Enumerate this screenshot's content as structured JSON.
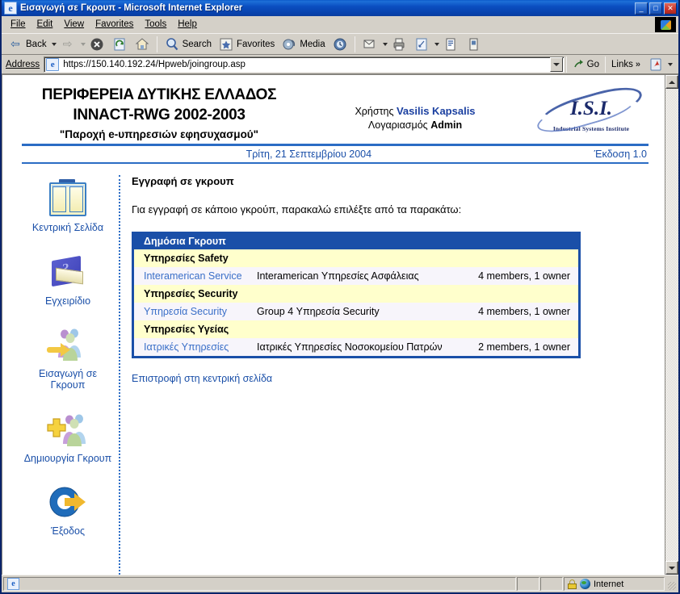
{
  "window": {
    "title": "Εισαγωγή σε Γκρουπ - Microsoft Internet Explorer",
    "minimize_label": "_",
    "maximize_label": "□",
    "close_label": "✕"
  },
  "menu": {
    "items": [
      {
        "label": "File"
      },
      {
        "label": "Edit"
      },
      {
        "label": "View"
      },
      {
        "label": "Favorites"
      },
      {
        "label": "Tools"
      },
      {
        "label": "Help"
      }
    ]
  },
  "toolbar": {
    "back_label": "Back",
    "forward_label": "",
    "stop_label": "",
    "refresh_label": "",
    "home_label": "",
    "search_label": "Search",
    "favorites_label": "Favorites",
    "media_label": "Media",
    "history_label": "",
    "mail_label": "",
    "print_label": "",
    "edit_label": "",
    "discuss_label": "",
    "messenger_label": ""
  },
  "address": {
    "label": "Address",
    "url": "https://150.140.192.24/Hpweb/joingroup.asp",
    "go_label": "Go",
    "links_label": "Links",
    "links_chevron": "»"
  },
  "site_header": {
    "line1": "ΠΕΡΙΦΕΡΕΙΑ ΔΥΤΙΚΗΣ ΕΛΛΑΔΟΣ",
    "line2": "INNACT-RWG 2002-2003",
    "line3": "\"Παροχή e-υπηρεσιών εφησυχασμού\"",
    "user_label": "Χρήστης",
    "user_name": "Vasilis Kapsalis",
    "account_label": "Λογαριασμός",
    "account_name": "Admin",
    "logo_text": "I.S.I.",
    "logo_subtitle": "Industrial Systems Institute",
    "date": "Τρίτη, 21 Σεπτεμβρίου 2004",
    "version": "Έκδοση 1.0",
    "accent_color": "#2b6cc4"
  },
  "sidebar": {
    "items": [
      {
        "label": "Κεντρική Σελίδα",
        "icon": "home-pages-icon"
      },
      {
        "label": "Εγχειρίδιο",
        "icon": "manual-book-icon"
      },
      {
        "label": "Εισαγωγή σε Γκρουπ",
        "icon": "join-group-icon"
      },
      {
        "label": "Δημιουργία Γκρουπ",
        "icon": "create-group-icon"
      },
      {
        "label": "Έξοδος",
        "icon": "exit-icon"
      }
    ]
  },
  "main": {
    "title": "Εγγραφή σε γκρουπ",
    "lead": "Για εγγραφή σε κάποιο γκρούπ, παρακαλώ επιλέξτε από τα παρακάτω:",
    "table_header": "Δημόσια Γκρουπ",
    "rows": [
      {
        "type": "category",
        "label": "Υπηρεσίες Safety"
      },
      {
        "type": "group",
        "link": "Interamerican Service",
        "description": "Interamerican Υπηρεσίες Ασφάλειας",
        "members": "4 members, 1 owner"
      },
      {
        "type": "category",
        "label": "Υπηρεσίες Security"
      },
      {
        "type": "group",
        "link": "Υπηρεσία Security",
        "description": "Group 4 Υπηρεσία Security",
        "members": "4 members, 1 owner"
      },
      {
        "type": "category",
        "label": "Υπηρεσίες Υγείας"
      },
      {
        "type": "group",
        "link": "Ιατρικές Υπηρεσίες",
        "description": "Ιατρικές Υπηρεσίες Νοσοκομείου Πατρών",
        "members": "2 members, 1 owner"
      }
    ],
    "back_link": "Επιστροφή στη κεντρική σελίδα",
    "header_bg": "#1a4fa8",
    "category_bg": "#ffffcc",
    "row_bg": "#f7f5fb",
    "link_color": "#3a6fc8"
  },
  "statusbar": {
    "message": "",
    "zone": "Internet"
  }
}
